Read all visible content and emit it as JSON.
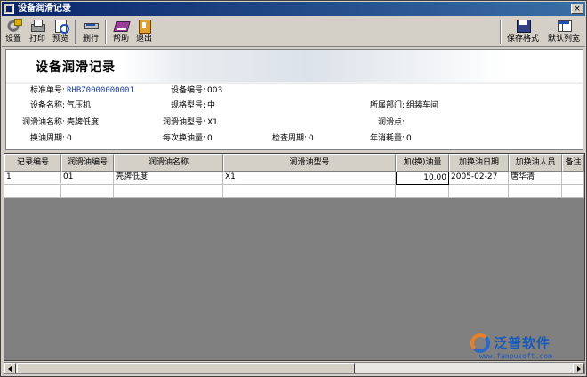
{
  "window": {
    "title": "设备润滑记录",
    "close_glyph": "×"
  },
  "toolbar": {
    "left": [
      {
        "label": "设置",
        "icon": "settings-icon"
      },
      {
        "label": "打印",
        "icon": "printer-icon"
      },
      {
        "label": "预览",
        "icon": "preview-icon"
      },
      {
        "label": "删行",
        "icon": "delete-row-icon"
      },
      {
        "label": "帮助",
        "icon": "help-book-icon"
      },
      {
        "label": "退出",
        "icon": "exit-door-icon"
      }
    ],
    "right": [
      {
        "label": "保存格式",
        "icon": "save-format-icon"
      },
      {
        "label": "默认列宽",
        "icon": "default-width-icon"
      }
    ]
  },
  "header": {
    "title": "设备润滑记录",
    "fields": {
      "std_no": {
        "label": "标准单号:",
        "value": "RHBZ0000000001"
      },
      "equip_no": {
        "label": "设备编号:",
        "value": "003"
      },
      "equip_name": {
        "label": "设备名称:",
        "value": "气压机"
      },
      "spec": {
        "label": "规格型号:",
        "value": "中"
      },
      "dept": {
        "label": "所属部门:",
        "value": "组装车间"
      },
      "oil_name": {
        "label": "润滑油名称:",
        "value": "壳牌低度"
      },
      "oil_model": {
        "label": "润滑油型号:",
        "value": "X1"
      },
      "point": {
        "label": "润滑点:",
        "value": ""
      },
      "cycle": {
        "label": "换油周期:",
        "value": "0"
      },
      "each_qty": {
        "label": "每次换油量:",
        "value": "0"
      },
      "check_cycle": {
        "label": "检查周期:",
        "value": "0"
      },
      "annual": {
        "label": "年消耗量:",
        "value": "0"
      }
    }
  },
  "grid": {
    "columns": [
      "记录编号",
      "润滑油编号",
      "润滑油名称",
      "润滑油型号",
      "加(换)油量",
      "加换油日期",
      "加换油人员",
      "备注"
    ],
    "rows": [
      [
        "1",
        "01",
        "壳牌低度",
        "X1",
        "10.00",
        "2005-02-27",
        "唐华清",
        ""
      ],
      [
        "",
        "",
        "",
        "",
        "",
        "",
        "",
        ""
      ]
    ]
  },
  "logo": {
    "name": "泛普软件",
    "url": "www.fanpusoft.com"
  },
  "colors": {
    "title_bar": "#0a246a",
    "accent_blue": "#1a5ab8",
    "logo_orange": "#e8802a"
  }
}
